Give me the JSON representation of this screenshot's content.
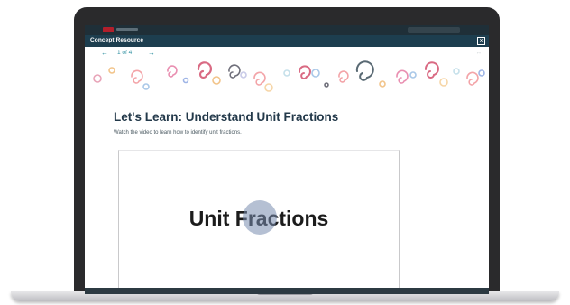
{
  "panel": {
    "title": "Concept Resource",
    "close_glyph": "×"
  },
  "nav": {
    "prev_glyph": "←",
    "next_glyph": "→",
    "page_counter": "1 of 4",
    "right_glyph": "↔"
  },
  "lesson": {
    "title": "Let's Learn: Understand Unit Fractions",
    "subtitle": "Watch the video to learn how to identify unit fractions."
  },
  "video": {
    "title": "Unit Fractions"
  },
  "colors": {
    "accent": "#2d8fa0",
    "header": "#1d3e4f",
    "brand": "#b21f2b"
  },
  "icons": [
    "close-icon",
    "arrow-left-icon",
    "arrow-right-icon",
    "expand-icon",
    "swirl-decoration"
  ]
}
